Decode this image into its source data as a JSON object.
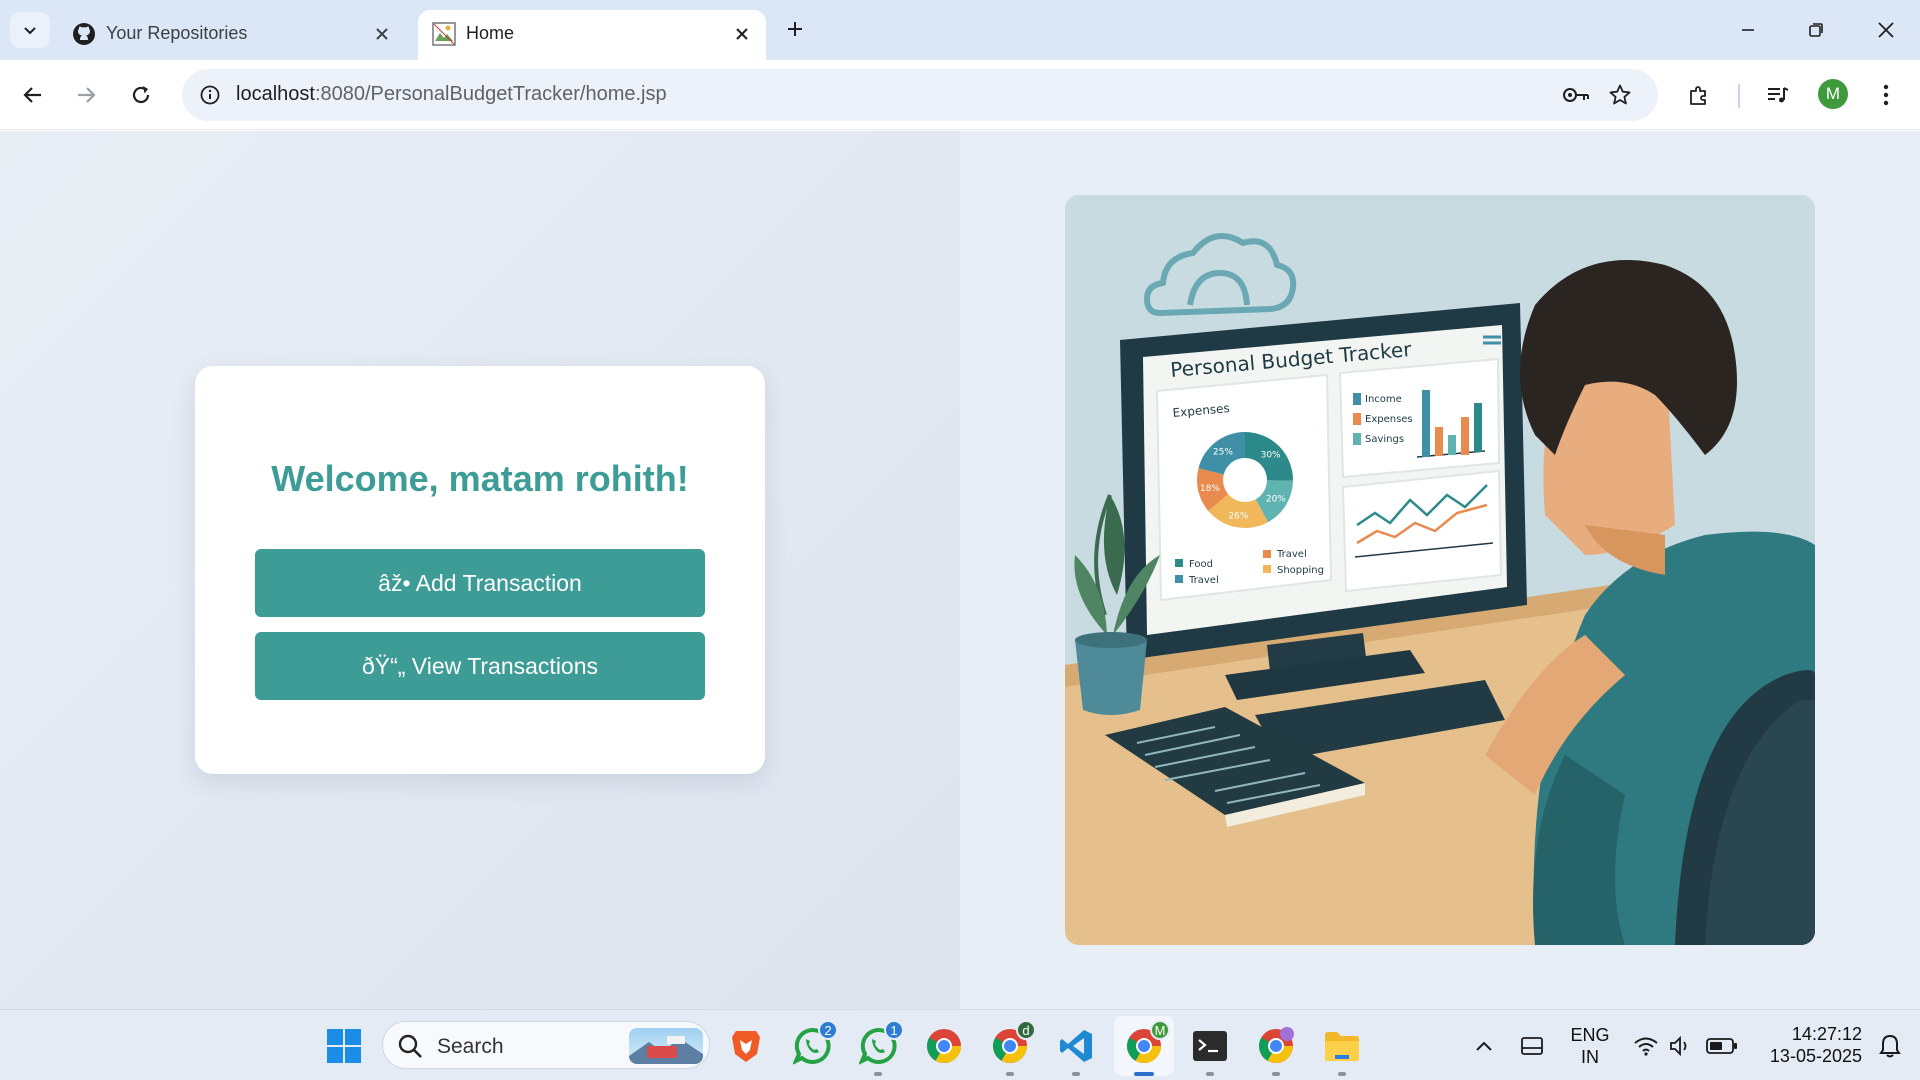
{
  "browser": {
    "tabs": [
      {
        "title": "Your Repositories",
        "icon": "github-icon",
        "active": false
      },
      {
        "title": "Home",
        "icon": "page-favicon-icon",
        "active": true
      }
    ],
    "url_host": "localhost",
    "url_path": ":8080/PersonalBudgetTracker/home.jsp",
    "profile_initial": "M"
  },
  "page": {
    "welcome": "Welcome, matam rohith!",
    "add_button": "âž• Add Transaction",
    "view_button": "ðŸ“„ View Transactions"
  },
  "illustration": {
    "screen_title": "Personal Budget Tracker",
    "expenses_label": "Expenses",
    "pie": [
      {
        "label": "30%",
        "value": 30,
        "color": "#2d8a8a"
      },
      {
        "label": "20%",
        "value": 20,
        "color": "#5fb3b0"
      },
      {
        "label": "26%",
        "value": 26,
        "color": "#f0b85a"
      },
      {
        "label": "18%",
        "value": 18,
        "color": "#e98a4e"
      },
      {
        "label": "25%",
        "value": 25,
        "color": "#3f8fa6"
      }
    ],
    "pie_legend": [
      "Food",
      "Travel",
      "Travel",
      "Shopping"
    ],
    "bar_legend": [
      "Income",
      "Expenses",
      "Savings"
    ]
  },
  "taskbar": {
    "search_label": "Search",
    "whatsapp_badge": "2",
    "whatsapp2_badge": "1",
    "chrome_profile_badge": "d",
    "chrome_active_badge": "M",
    "lang_top": "ENG",
    "lang_bottom": "IN",
    "time": "14:27:12",
    "date": "13-05-2025"
  },
  "colors": {
    "accent": "#3e9c96",
    "page_bg": "#e4eaf2"
  }
}
